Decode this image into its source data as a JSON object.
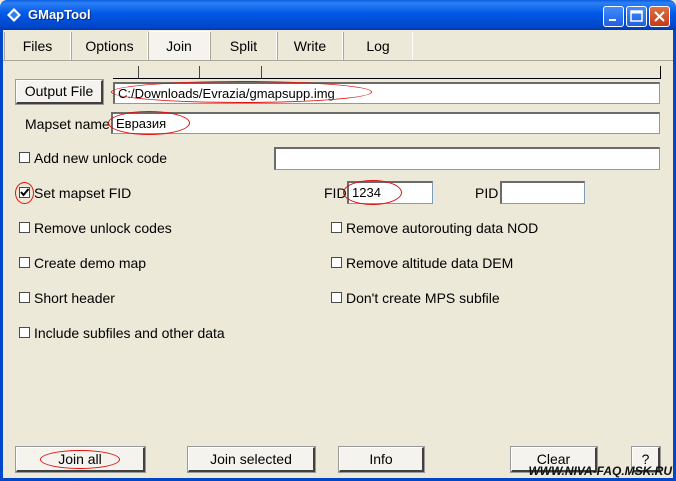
{
  "window": {
    "title": "GMapTool"
  },
  "tabs": [
    {
      "label": "Files"
    },
    {
      "label": "Options"
    },
    {
      "label": "Join"
    },
    {
      "label": "Split"
    },
    {
      "label": "Write"
    },
    {
      "label": "Log"
    }
  ],
  "active_tab": "Join",
  "join": {
    "output_button": "Output File",
    "output_path": "C:/Downloads/Evrazia/gmapsupp.img",
    "mapset_name_label": "Mapset name",
    "mapset_name_value": "Евразия",
    "add_unlock_label": "Add new unlock code",
    "add_unlock_value": "",
    "set_fid_label": "Set mapset FID",
    "fid_label": "FID",
    "fid_value": "1234",
    "pid_label": "PID",
    "pid_value": "",
    "options": {
      "remove_unlock": "Remove unlock codes",
      "create_demo": "Create demo map",
      "short_header": "Short header",
      "include_subfiles": "Include subfiles and other data",
      "remove_nod": "Remove autorouting data NOD",
      "remove_dem": "Remove altitude data DEM",
      "no_mps": "Don't create MPS subfile"
    },
    "buttons": {
      "join_all": "Join all",
      "join_selected": "Join selected",
      "info": "Info",
      "clear": "Clear",
      "help": "?"
    }
  },
  "watermark": "WWW.NIVA-FAQ.MSK.RU",
  "colors": {
    "titlebar": "#0058e6",
    "annotation": "#e01010",
    "window_bg": "#ece9d8"
  }
}
